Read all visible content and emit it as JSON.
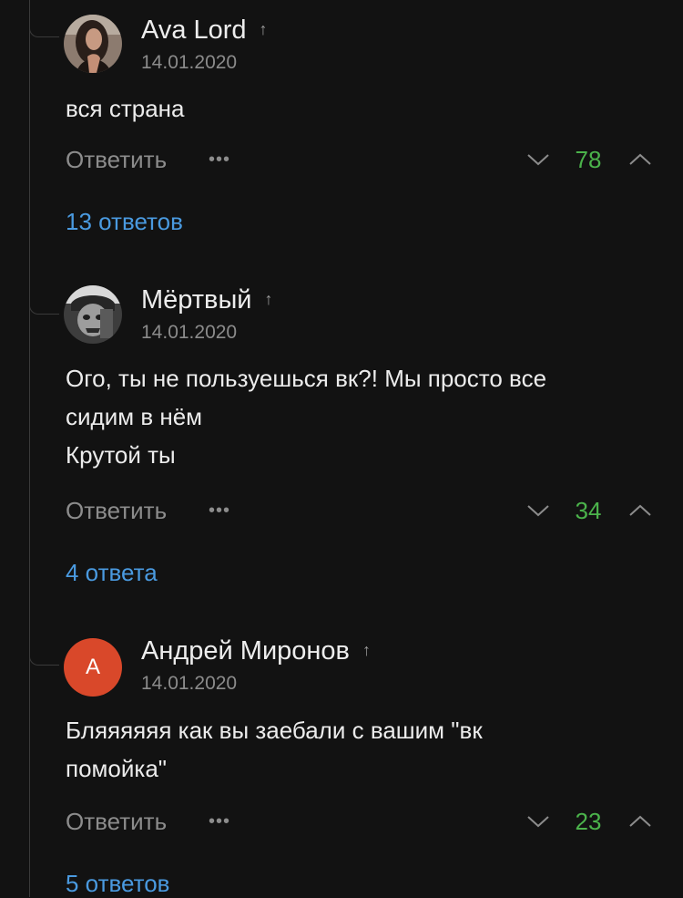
{
  "thread": {
    "comments": [
      {
        "author": "Ava Lord",
        "date": "14.01.2020",
        "text_lines": [
          "вся страна"
        ],
        "reply_label": "Ответить",
        "more_label": "•••",
        "score": "78",
        "answers_label": "13 ответов",
        "avatar_icon": "woman-photo-avatar"
      },
      {
        "author": "Мёртвый",
        "date": "14.01.2020",
        "text_lines": [
          "Ого, ты не пользуешься вк?! Мы просто все",
          "сидим в нём",
          "Крутой ты"
        ],
        "reply_label": "Ответить",
        "more_label": "•••",
        "score": "34",
        "answers_label": "4 ответа",
        "avatar_icon": "zombie-photo-avatar"
      },
      {
        "author": "Андрей Миронов",
        "date": "14.01.2020",
        "text_lines": [
          "Бляяяяяя как вы заебали с вашим \"вк",
          "помойка\""
        ],
        "reply_label": "Ответить",
        "more_label": "•••",
        "score": "23",
        "answers_label": "5 ответов",
        "avatar_letter": "А",
        "avatar_color": "#d9482a"
      }
    ]
  },
  "colors": {
    "background": "#121212",
    "score": "#4bb34b",
    "link": "#4a9ae0",
    "muted": "#8c8c8c"
  },
  "icons": {
    "author_marker": "↑",
    "vote_down": "chevron-down-icon",
    "vote_up": "chevron-up-icon"
  }
}
